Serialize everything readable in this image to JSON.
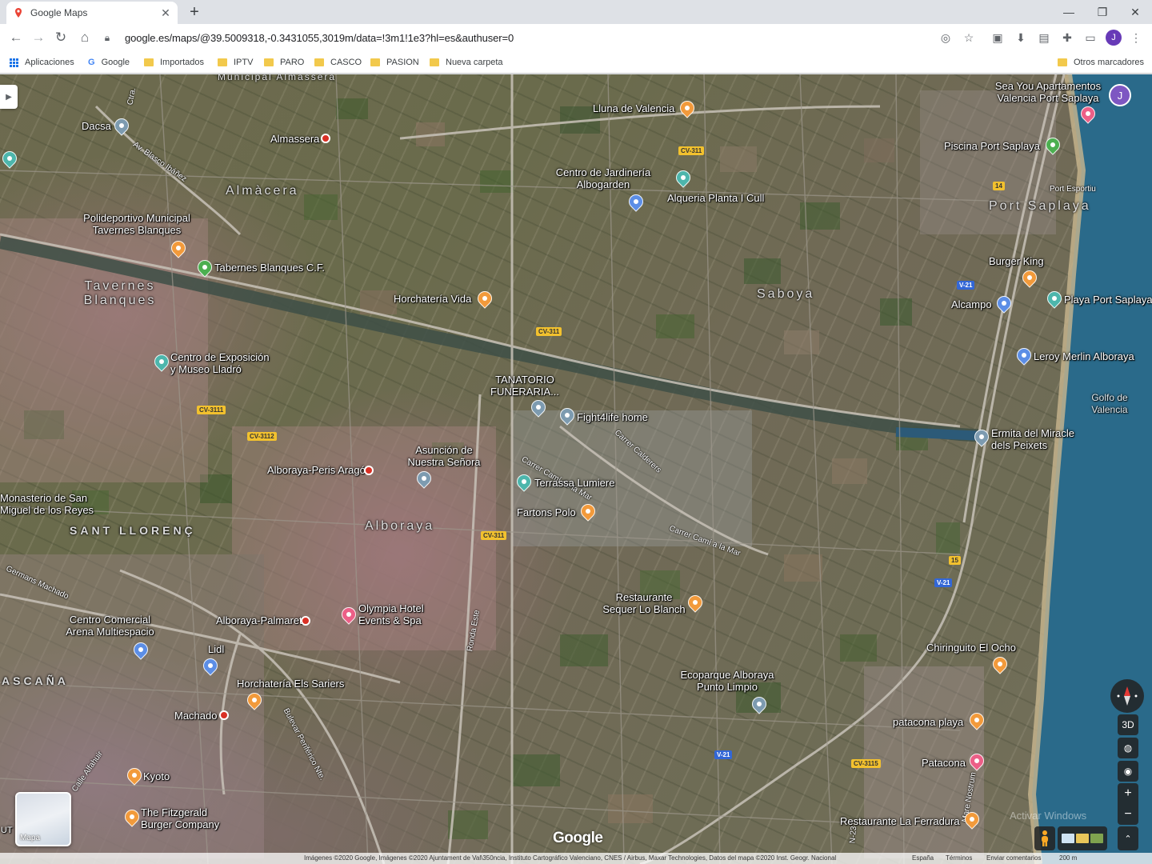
{
  "browser": {
    "tab_title": "Google Maps",
    "url": "google.es/maps/@39.5009318,-0.3431055,3019m/data=!3m1!1e3?hl=es&authuser=0",
    "profile_initial": "J",
    "window_controls": {
      "minimize": "—",
      "restore": "❐",
      "close": "✕"
    },
    "new_tab": "+"
  },
  "bookmarks": {
    "items": [
      "Aplicaciones",
      "Google",
      "Importados",
      "IPTV",
      "PARO",
      "CASCO",
      "PASION",
      "Nueva carpeta"
    ],
    "other": "Otros marcadores"
  },
  "map": {
    "account_initial": "J",
    "places": {
      "almacera": "Almàcera",
      "tavernes": "Tavernes Blanques",
      "saboya": "Saboya",
      "alboraya": "Alboraya",
      "port_saplaya": "Port Saplaya",
      "sant_llorenc": "SANT LLORENÇ",
      "ascana": "ASCAÑA",
      "municipal": "Municipal Almassera",
      "golfo": "Golfo de Valencia"
    },
    "pois": {
      "dacsa": "Dacsa",
      "almassera": "Almassera",
      "polideportivo": "Polideportivo Municipal Tavernes Blanques",
      "tabernes_cf": "Tabernes Blanques C.F.",
      "horchateria_vida": "Horchatería Vida",
      "lluna": "Lluna de Valencia",
      "jardineria": "Centro de Jardinería Albogarden",
      "alqueria": "Alqueria Planta I Cull",
      "sea_you": "Sea You Apartamentos Valencia Port Saplaya",
      "piscina": "Piscina Port Saplaya",
      "port_esportiu": "Port Esportiu",
      "burger_king": "Burger King",
      "alcampo": "Alcampo",
      "playa_port": "Playa Port Saplaya",
      "leroy": "Leroy Merlin Alboraya",
      "museo_lladro": "Centro de Exposición y Museo Lladró",
      "tanatorio": "TANATORIO FUNERARIA...",
      "fight4life": "Fight4life home",
      "asuncion": "Asunción de Nuestra Señora",
      "peris_arago": "Alboraya-Peris Aragó",
      "monasterio": "Monasterio de San Miguel de los Reyes",
      "terrassa": "Terrassa Lumiere",
      "fartons": "Fartons Polo",
      "ermita": "Ermita del Miracle dels Peixets",
      "restaurante_sequer": "Restaurante Sequer Lo Blanch",
      "centro_comercial": "Centro Comercial Arena Multiespacio",
      "palmaret": "Alboraya-Palmaret",
      "olympia": "Olympia Hotel Events & Spa",
      "lidl": "Lidl",
      "horchateria_sariers": "Horchatería Els Sariers",
      "machado": "Machado",
      "ecoparque": "Ecoparque Alboraya Punto Limpio",
      "chiringuito": "Chiringuito El Ocho",
      "patacona_playa": "patacona playa",
      "patacona": "Patacona",
      "kyoto": "Kyoto",
      "fitzgerald": "The Fitzgerald Burger Company",
      "ferradura": "Restaurante La Ferradura"
    },
    "streets": {
      "blasco": "Av. Blasco Ibáñez",
      "calderers": "Carrer Calderers",
      "cami_mar": "Carrer Camí a la Mar",
      "camino_mar": "Carrer Camí de la Mar",
      "germans": "Germans Machado",
      "ronda": "Ronda Este",
      "bulevar": "Bulevar Periférico Nte.",
      "alfahuir": "Calle Alfahuir",
      "mare": "Mare Nostrum",
      "n23": "N-23",
      "ctra": "Ctra."
    },
    "road_signs": [
      "CV-311",
      "CV-311",
      "CV-311",
      "CV-3111",
      "CV-3112",
      "V-21",
      "V-21",
      "V-21",
      "CV-3115",
      "14",
      "15"
    ],
    "controls": {
      "tilt": "3D",
      "zoom_in": "+",
      "zoom_out": "−",
      "expand": "⌃"
    },
    "minimap_label": "Mapa",
    "google_logo": "Google",
    "watermark": "Activar Windows",
    "edge_label": "UT",
    "attribution": {
      "imagery": "Imágenes ©2020 Google, Imágenes ©2020 Ajuntament de Val\\350ncia, Instituto Cartográfico Valenciano, CNES / Airbus, Maxar Technologies, Datos del mapa ©2020 Inst. Geogr. Nacional",
      "country": "España",
      "terms": "Términos",
      "feedback": "Enviar comentarios",
      "scale": "200 m"
    }
  },
  "colors": {
    "accent": "#1a73e8",
    "profile": "#673ab7",
    "road_sign": "#f2c12e",
    "sea": "#2f6f8f"
  }
}
